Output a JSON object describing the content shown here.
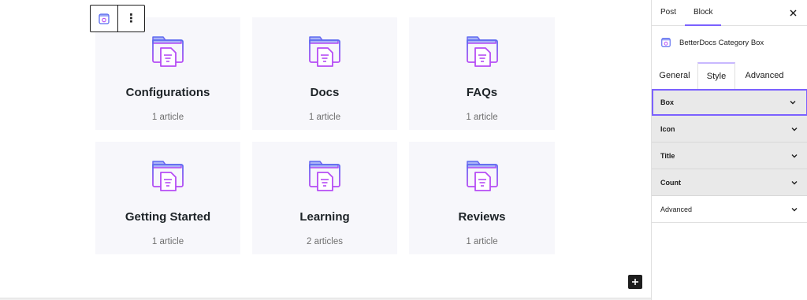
{
  "canvas": {
    "cards": [
      {
        "title": "Configurations",
        "count": "1 article"
      },
      {
        "title": "Docs",
        "count": "1 article"
      },
      {
        "title": "FAQs",
        "count": "1 article"
      },
      {
        "title": "Getting Started",
        "count": "1 article"
      },
      {
        "title": "Learning",
        "count": "2 articles"
      },
      {
        "title": "Reviews",
        "count": "1 article"
      }
    ]
  },
  "sidebar": {
    "tabs": [
      "Post",
      "Block"
    ],
    "active_tab": "Block",
    "block_name": "BetterDocs Category Box",
    "settings_tabs": [
      "General",
      "Style",
      "Advanced"
    ],
    "active_settings_tab": "Style",
    "panels": [
      "Box",
      "Icon",
      "Title",
      "Count",
      "Advanced"
    ]
  },
  "colors": {
    "accent": "#7b61ff",
    "icon_blue": "#5b6cf0",
    "icon_purple": "#b64cf5",
    "card_bg": "#f7f7fb"
  },
  "icons": {
    "toolbar_block": "category-box-icon",
    "toolbar_more": "more-vertical-icon",
    "card": "folder-document-icon",
    "close": "close-icon",
    "panel_toggle": "chevron-down-icon",
    "inserter": "plus-icon"
  }
}
